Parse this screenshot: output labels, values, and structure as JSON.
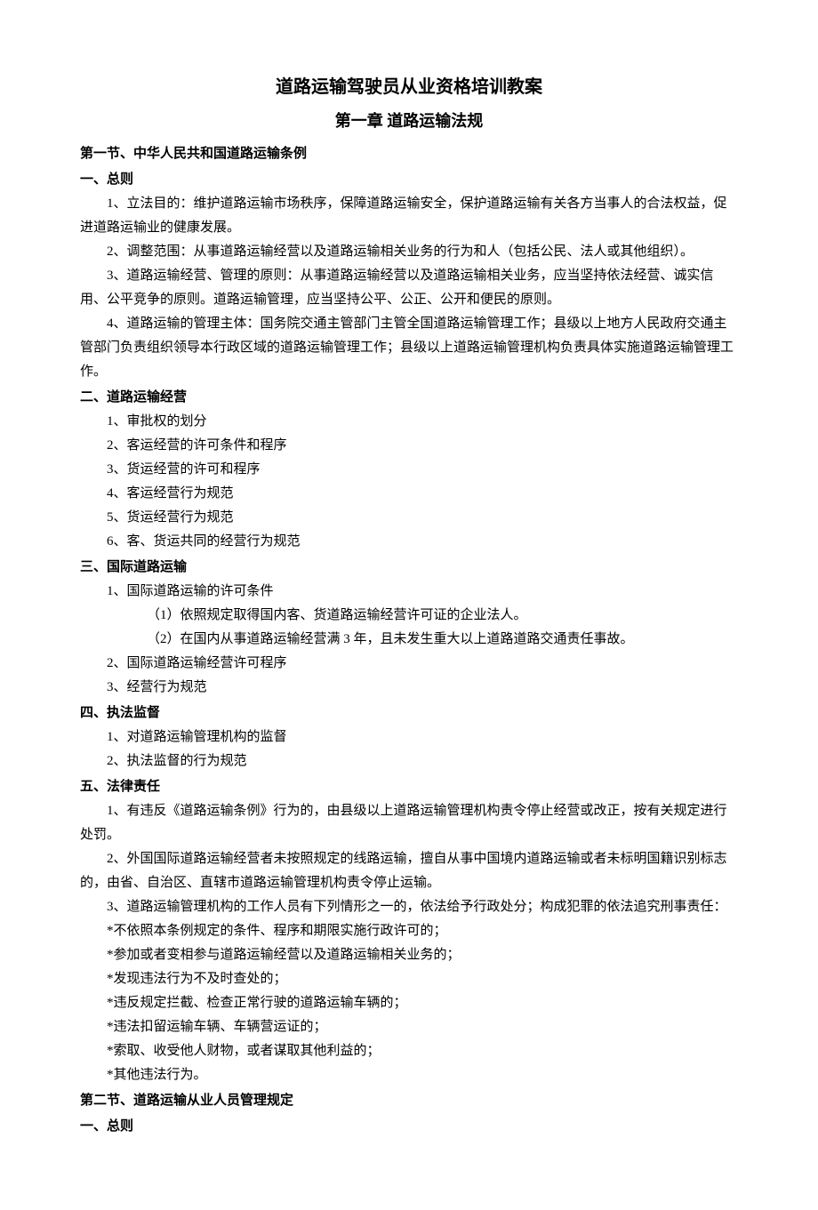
{
  "title": "道路运输驾驶员从业资格培训教案",
  "chapter": "第一章 道路运输法规",
  "section1": {
    "heading": "第一节、中华人民共和国道路运输条例",
    "h1": "一、总则",
    "p1": "1、立法目的：维护道路运输市场秩序，保障道路运输安全，保护道路运输有关各方当事人的合法权益，促进道路运输业的健康发展。",
    "p2": "2、调整范围：从事道路运输经营以及道路运输相关业务的行为和人（包括公民、法人或其他组织）。",
    "p3": "3、道路运输经营、管理的原则：从事道路运输经营以及道路运输相关业务，应当坚持依法经营、诚实信用、公平竞争的原则。道路运输管理，应当坚持公平、公正、公开和便民的原则。",
    "p4": "4、道路运输的管理主体：国务院交通主管部门主管全国道路运输管理工作；县级以上地方人民政府交通主管部门负责组织领导本行政区域的道路运输管理工作；县级以上道路运输管理机构负责具体实施道路运输管理工作。",
    "h2": "二、道路运输经营",
    "l2_1": "1、审批权的划分",
    "l2_2": "2、客运经营的许可条件和程序",
    "l2_3": "3、货运经营的许可和程序",
    "l2_4": "4、客运经营行为规范",
    "l2_5": "5、货运经营行为规范",
    "l2_6": "6、客、货运共同的经营行为规范",
    "h3": "三、国际道路运输",
    "l3_1": "1、国际道路运输的许可条件",
    "l3_1a": "（1）依照规定取得国内客、货道路运输经营许可证的企业法人。",
    "l3_1b": "（2）在国内从事道路运输经营满 3 年，且未发生重大以上道路道路交通责任事故。",
    "l3_2": "2、国际道路运输经营许可程序",
    "l3_3": "3、经营行为规范",
    "h4": "四、执法监督",
    "l4_1": "1、对道路运输管理机构的监督",
    "l4_2": "2、执法监督的行为规范",
    "h5": "五、法律责任",
    "p5_1": "1、有违反《道路运输条例》行为的，由县级以上道路运输管理机构责令停止经营或改正，按有关规定进行处罚。",
    "p5_2": "2、外国国际道路运输经营者未按照规定的线路运输，擅自从事中国境内道路运输或者未标明国籍识别标志的，由省、自治区、直辖市道路运输管理机构责令停止运输。",
    "p5_3": "3、道路运输管理机构的工作人员有下列情形之一的，依法给予行政处分；构成犯罪的依法追究刑事责任：",
    "s1": "*不依照本条例规定的条件、程序和期限实施行政许可的；",
    "s2": "*参加或者变相参与道路运输经营以及道路运输相关业务的；",
    "s3": "*发现违法行为不及时查处的；",
    "s4": "*违反规定拦截、检查正常行驶的道路运输车辆的；",
    "s5": "*违法扣留运输车辆、车辆营运证的；",
    "s6": "*索取、收受他人财物，或者谋取其他利益的；",
    "s7": "*其他违法行为。"
  },
  "section2": {
    "heading": "第二节、道路运输从业人员管理规定",
    "h1": "一、总则"
  }
}
